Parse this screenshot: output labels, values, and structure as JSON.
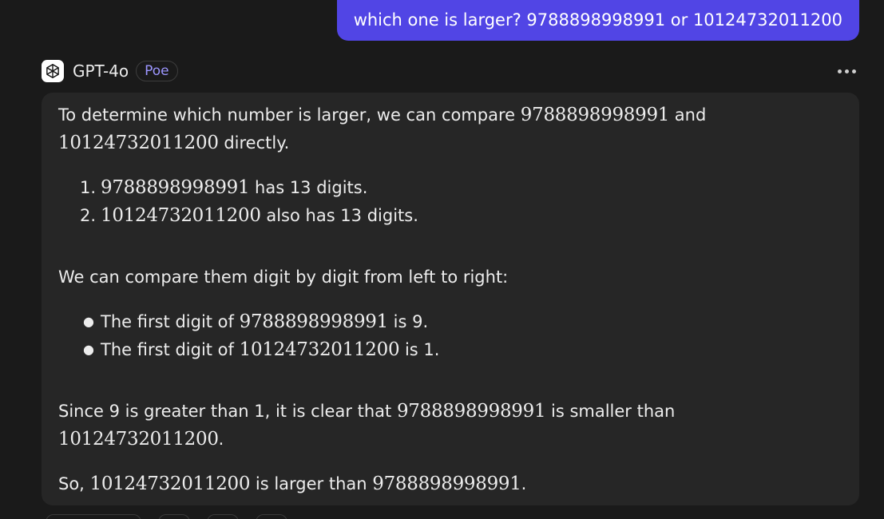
{
  "user_message": {
    "text": "which one is larger? 9788898998991 or 10124732011200"
  },
  "bot": {
    "name": "GPT-4o",
    "badge": "Poe",
    "avatar_icon": "openai-logo-icon",
    "more_icon": "more-horizontal-icon"
  },
  "response": {
    "p1_a": "To determine which number is larger, we can compare ",
    "p1_m1": "9788898998991",
    "p1_b": " and",
    "p1_m2": "10124732011200",
    "p1_c": " directly.",
    "ol": [
      {
        "marker": "1.",
        "math": "9788898998991",
        "text": " has 13 digits."
      },
      {
        "marker": "2.",
        "math": "10124732011200",
        "text": " also has 13 digits."
      }
    ],
    "p2": "We can compare them digit by digit from left to right:",
    "ul": [
      {
        "pre": "The first digit of ",
        "math": "9788898998991",
        "post": " is 9."
      },
      {
        "pre": "The first digit of ",
        "math": "10124732011200",
        "post": " is 1."
      }
    ],
    "p3_a": "Since 9 is greater than 1, it is clear that ",
    "p3_m1": "9788898998991",
    "p3_b": " is smaller than",
    "p3_m2": "10124732011200",
    "p3_c": ".",
    "p4_a": "So, ",
    "p4_m1": "10124732011200",
    "p4_b": " is larger than ",
    "p4_m2": "9788898998991",
    "p4_c": "."
  },
  "colors": {
    "background": "#1a1a1a",
    "user_bubble": "#5145e5",
    "bot_bubble": "#262626",
    "badge_text": "#9c96ff"
  }
}
